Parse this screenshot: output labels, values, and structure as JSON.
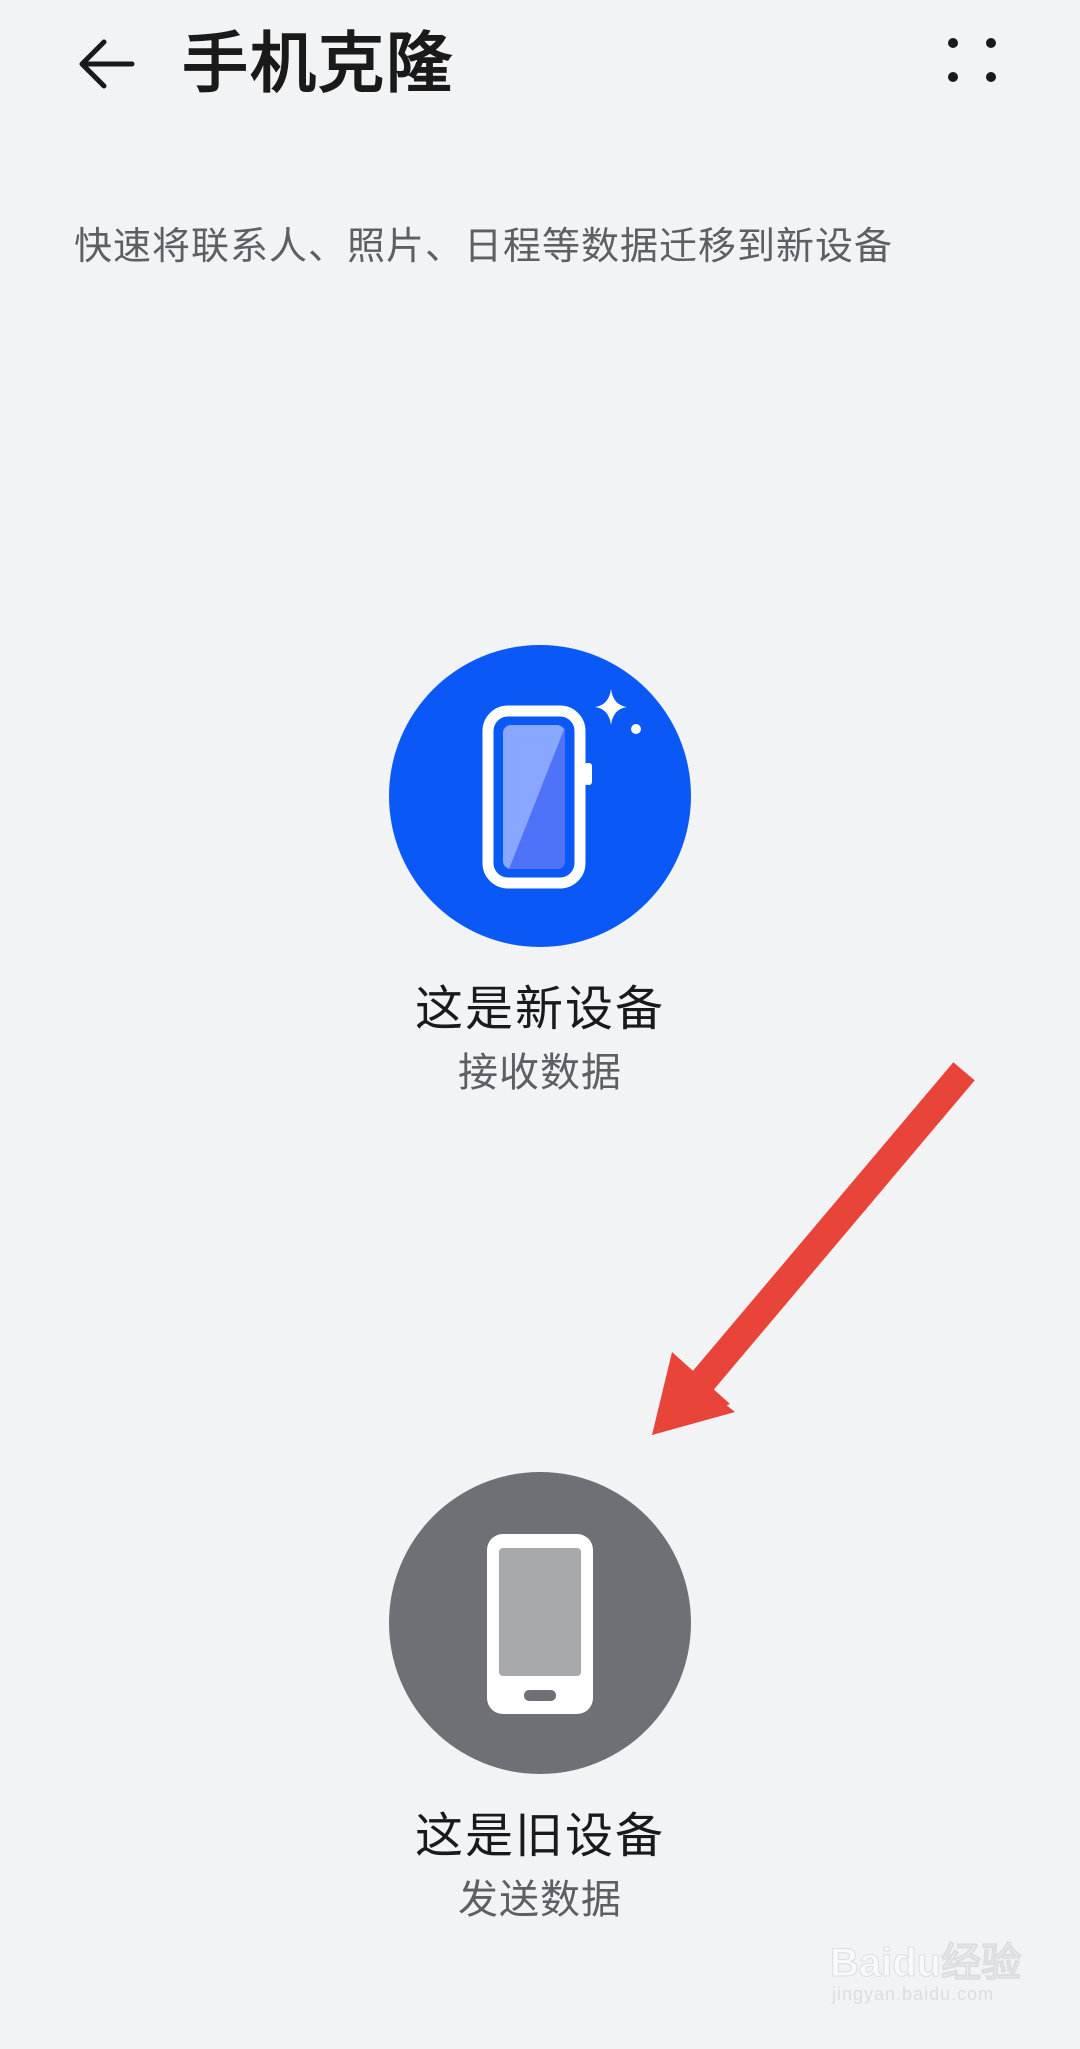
{
  "app_bar": {
    "title": "手机克隆",
    "back_icon": "arrow-left-icon",
    "more_icon": "more-dots-icon"
  },
  "subtitle": "快速将联系人、照片、日程等数据迁移到新设备",
  "options": {
    "new_device": {
      "title": "这是新设备",
      "subtitle": "接收数据",
      "icon": "new-phone-icon",
      "color": "#0a59f7"
    },
    "old_device": {
      "title": "这是旧设备",
      "subtitle": "发送数据",
      "icon": "old-phone-icon",
      "color": "#6e7076"
    }
  },
  "annotation": {
    "arrow_color": "#e8443a"
  },
  "watermark": {
    "brand": "Baidu经验",
    "url": "jingyan.baidu.com"
  }
}
